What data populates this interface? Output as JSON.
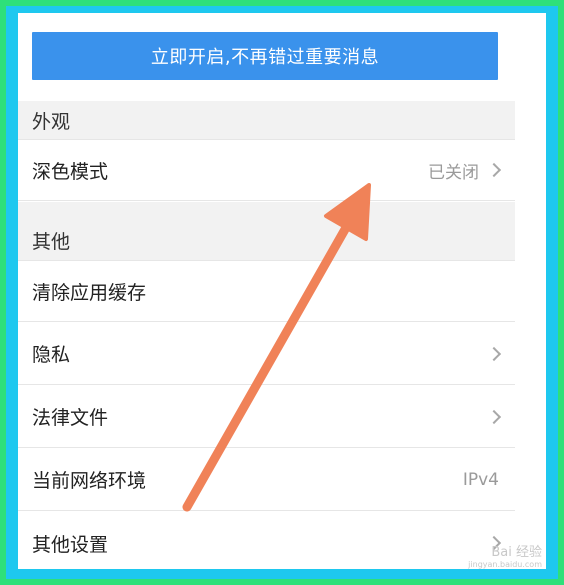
{
  "banner": {
    "label": "立即开启,不再错过重要消息"
  },
  "sections": {
    "appearance": "外观",
    "other": "其他"
  },
  "rows": {
    "dark_mode": {
      "label": "深色模式",
      "value": "已关闭"
    },
    "clear_cache": {
      "label": "清除应用缓存"
    },
    "privacy": {
      "label": "隐私"
    },
    "legal": {
      "label": "法律文件"
    },
    "network": {
      "label": "当前网络环境",
      "value": "IPv4"
    },
    "other_settings": {
      "label": "其他设置"
    }
  },
  "annotation": {
    "arrow_color": "#f08258"
  },
  "watermark": {
    "brand": "Bai 经验",
    "url": "jingyan.baidu.com"
  },
  "colors": {
    "banner": "#3a92ec",
    "frame_outer": "#2ee07a",
    "frame_inner": "#1ec8ef"
  }
}
